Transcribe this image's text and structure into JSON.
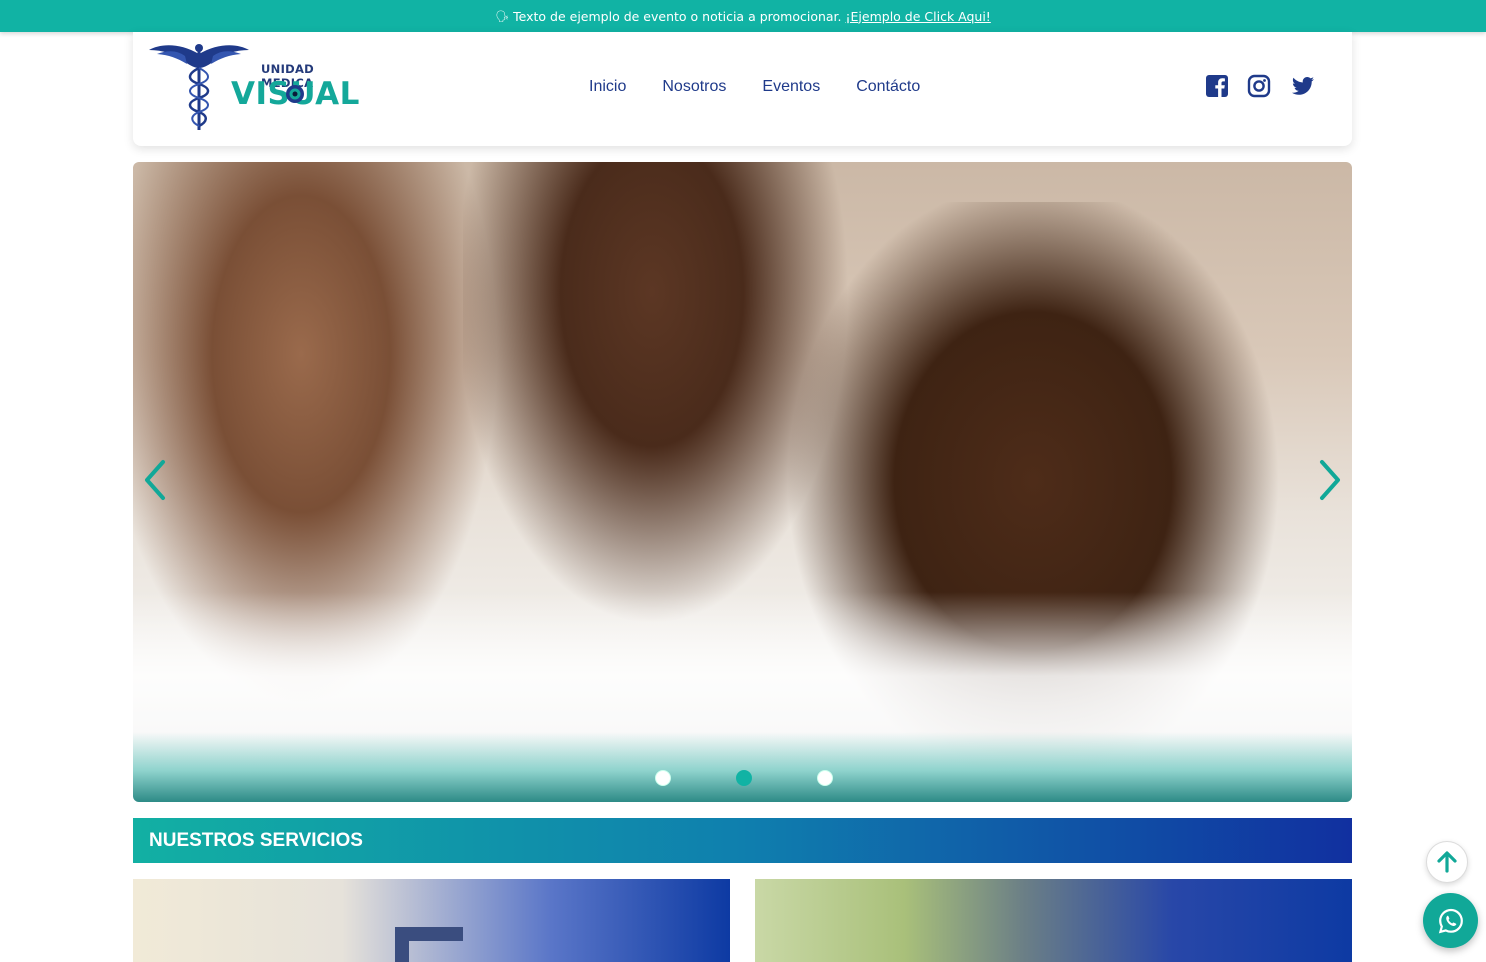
{
  "topbar": {
    "bullet": "🗣",
    "text": "Texto de ejemplo de evento o noticia a promocionar.",
    "link": "¡Ejemplo de Click Aqui!"
  },
  "logo": {
    "subtitle": "UNIDAD MEDICA",
    "word": "VISUAL"
  },
  "nav": {
    "items": [
      "Inicio",
      "Nosotros",
      "Eventos",
      "Contácto"
    ]
  },
  "social": {
    "icons": [
      "facebook-icon",
      "instagram-icon",
      "twitter-icon"
    ]
  },
  "hero": {
    "slides": 3,
    "active_slide": 2
  },
  "services": {
    "title": "NUESTROS SERVICIOS"
  },
  "colors": {
    "teal": "#11b3a4",
    "navy": "#1f3a8a",
    "blue": "#1130a0"
  }
}
